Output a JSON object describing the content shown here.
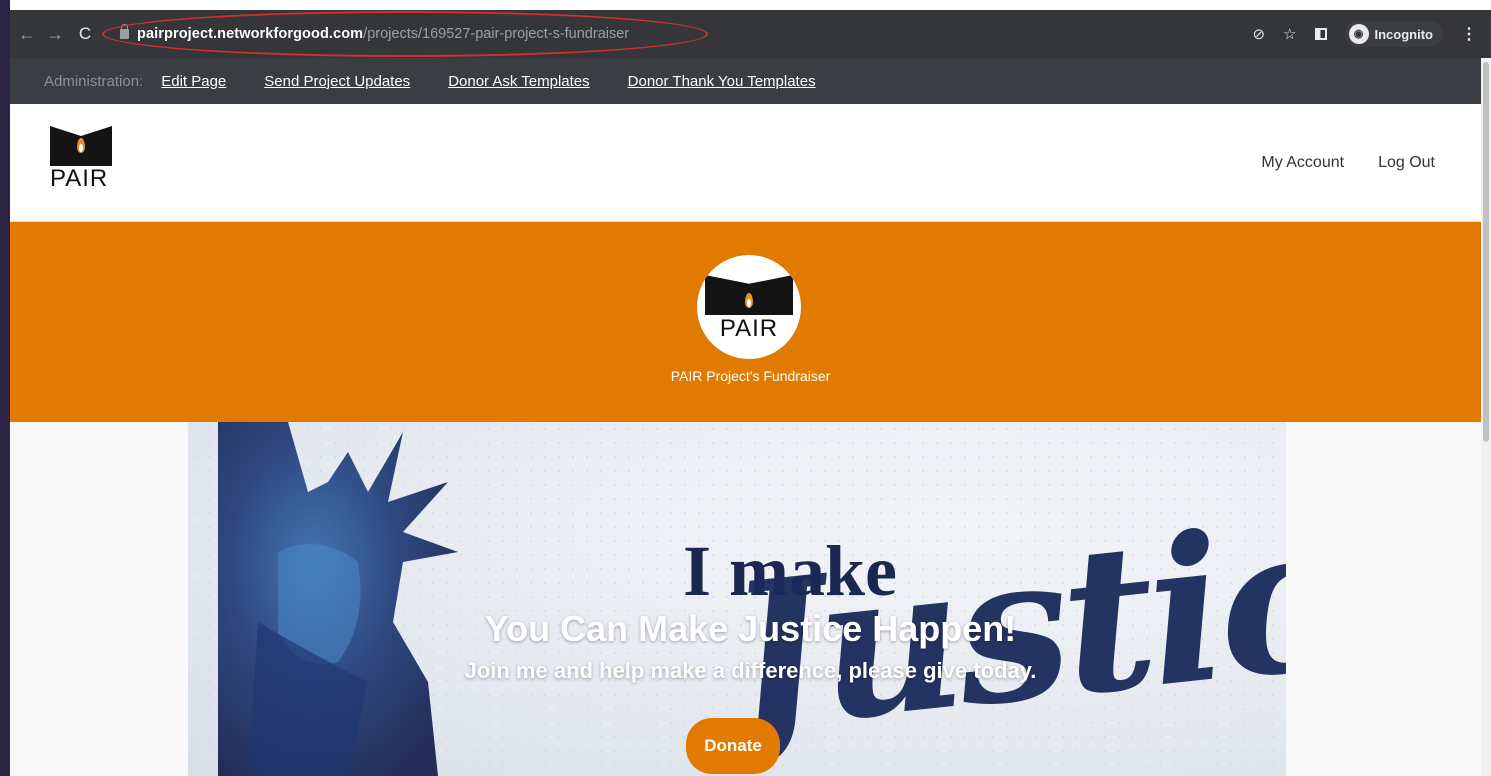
{
  "browser": {
    "url_host": "pairproject.networkforgood.com",
    "url_path": "/projects/169527-pair-project-s-fundraiser",
    "incognito_label": "Incognito",
    "back_glyph": "←",
    "forward_glyph": "→",
    "reload_glyph": "C",
    "star_glyph": "☆",
    "eye_off_glyph": "⊘",
    "kebab_glyph": "⋮"
  },
  "admin": {
    "label": "Administration:",
    "links": [
      "Edit Page",
      "Send Project Updates",
      "Donor Ask Templates",
      "Donor Thank You Templates"
    ]
  },
  "header": {
    "logo_word": "PAIR",
    "nav": [
      "My Account",
      "Log Out"
    ]
  },
  "banner": {
    "logo_word": "PAIR",
    "title": "PAIR Project's Fundraiser",
    "color": "#e07a00"
  },
  "hero": {
    "image_text_top": "I make",
    "image_text_script": "Justice",
    "headline": "You Can Make Justice Happen!",
    "subheadline": "Join me and help make a difference, please give today.",
    "donate_label": "Donate"
  }
}
